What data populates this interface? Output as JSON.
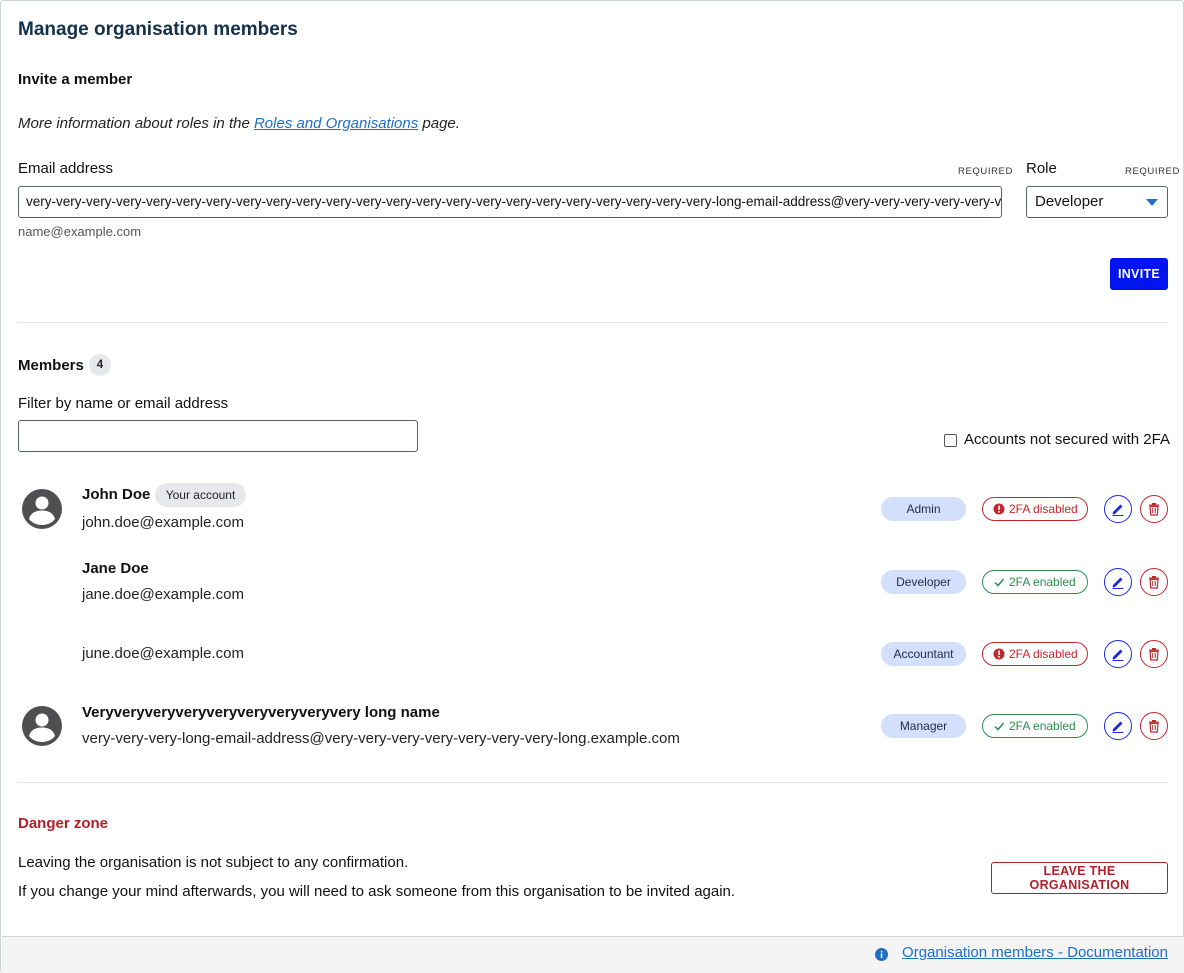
{
  "page": {
    "title": "Manage organisation members"
  },
  "invite": {
    "heading": "Invite a member",
    "info_prefix": "More information about roles in the",
    "info_link": "Roles and Organisations",
    "info_suffix": "page.",
    "email_label": "Email address",
    "email_required": "REQUIRED",
    "email_value": "very-very-very-very-very-very-very-very-very-very-very-very-very-very-very-very-very-very-very-very-very-very-very-long-email-address@very-very-very-very-very-very-very-long.e",
    "email_hint": "name@example.com",
    "role_label": "Role",
    "role_required": "REQUIRED",
    "role_value": "Developer",
    "invite_button": "INVITE"
  },
  "members": {
    "heading": "Members",
    "count": "4",
    "filter_label": "Filter by name or email address",
    "filter_value": "",
    "only_2fa_label": "Accounts not secured with 2FA",
    "list": [
      {
        "name": "John Doe",
        "badge": "Your account",
        "email": "john.doe@example.com",
        "role": "Admin",
        "tfa": "2FA disabled"
      },
      {
        "name": "Jane Doe",
        "email": "jane.doe@example.com",
        "role": "Developer",
        "tfa": "2FA enabled"
      },
      {
        "name": "",
        "email": "june.doe@example.com",
        "role": "Accountant",
        "tfa": "2FA disabled"
      },
      {
        "name": "Veryveryveryveryveryveryveryveryvery long name",
        "email": "very-very-very-long-email-address@very-very-very-very-very-very-very-long.example.com",
        "role": "Manager",
        "tfa": "2FA enabled"
      }
    ]
  },
  "danger": {
    "heading": "Danger zone",
    "line1": "Leaving the organisation is not subject to any confirmation.",
    "line2": "If you change your mind afterwards, you will need to ask someone from this organisation to be invited again.",
    "leave_button": "LEAVE THE ORGANISATION"
  },
  "footer": {
    "doc_link": "Organisation members - Documentation"
  },
  "colors": {
    "primary": "#0014f0",
    "danger": "#c4262e",
    "success": "#2c8d4d",
    "link": "#1f6fc5",
    "title": "#14304a"
  },
  "icons": {
    "avatar": "user-circle-icon",
    "edit": "pencil-icon",
    "delete": "trash-icon",
    "tfa_disabled": "error-circle-icon",
    "tfa_enabled": "check-icon",
    "info": "info-icon",
    "select": "chevron-down-icon"
  }
}
